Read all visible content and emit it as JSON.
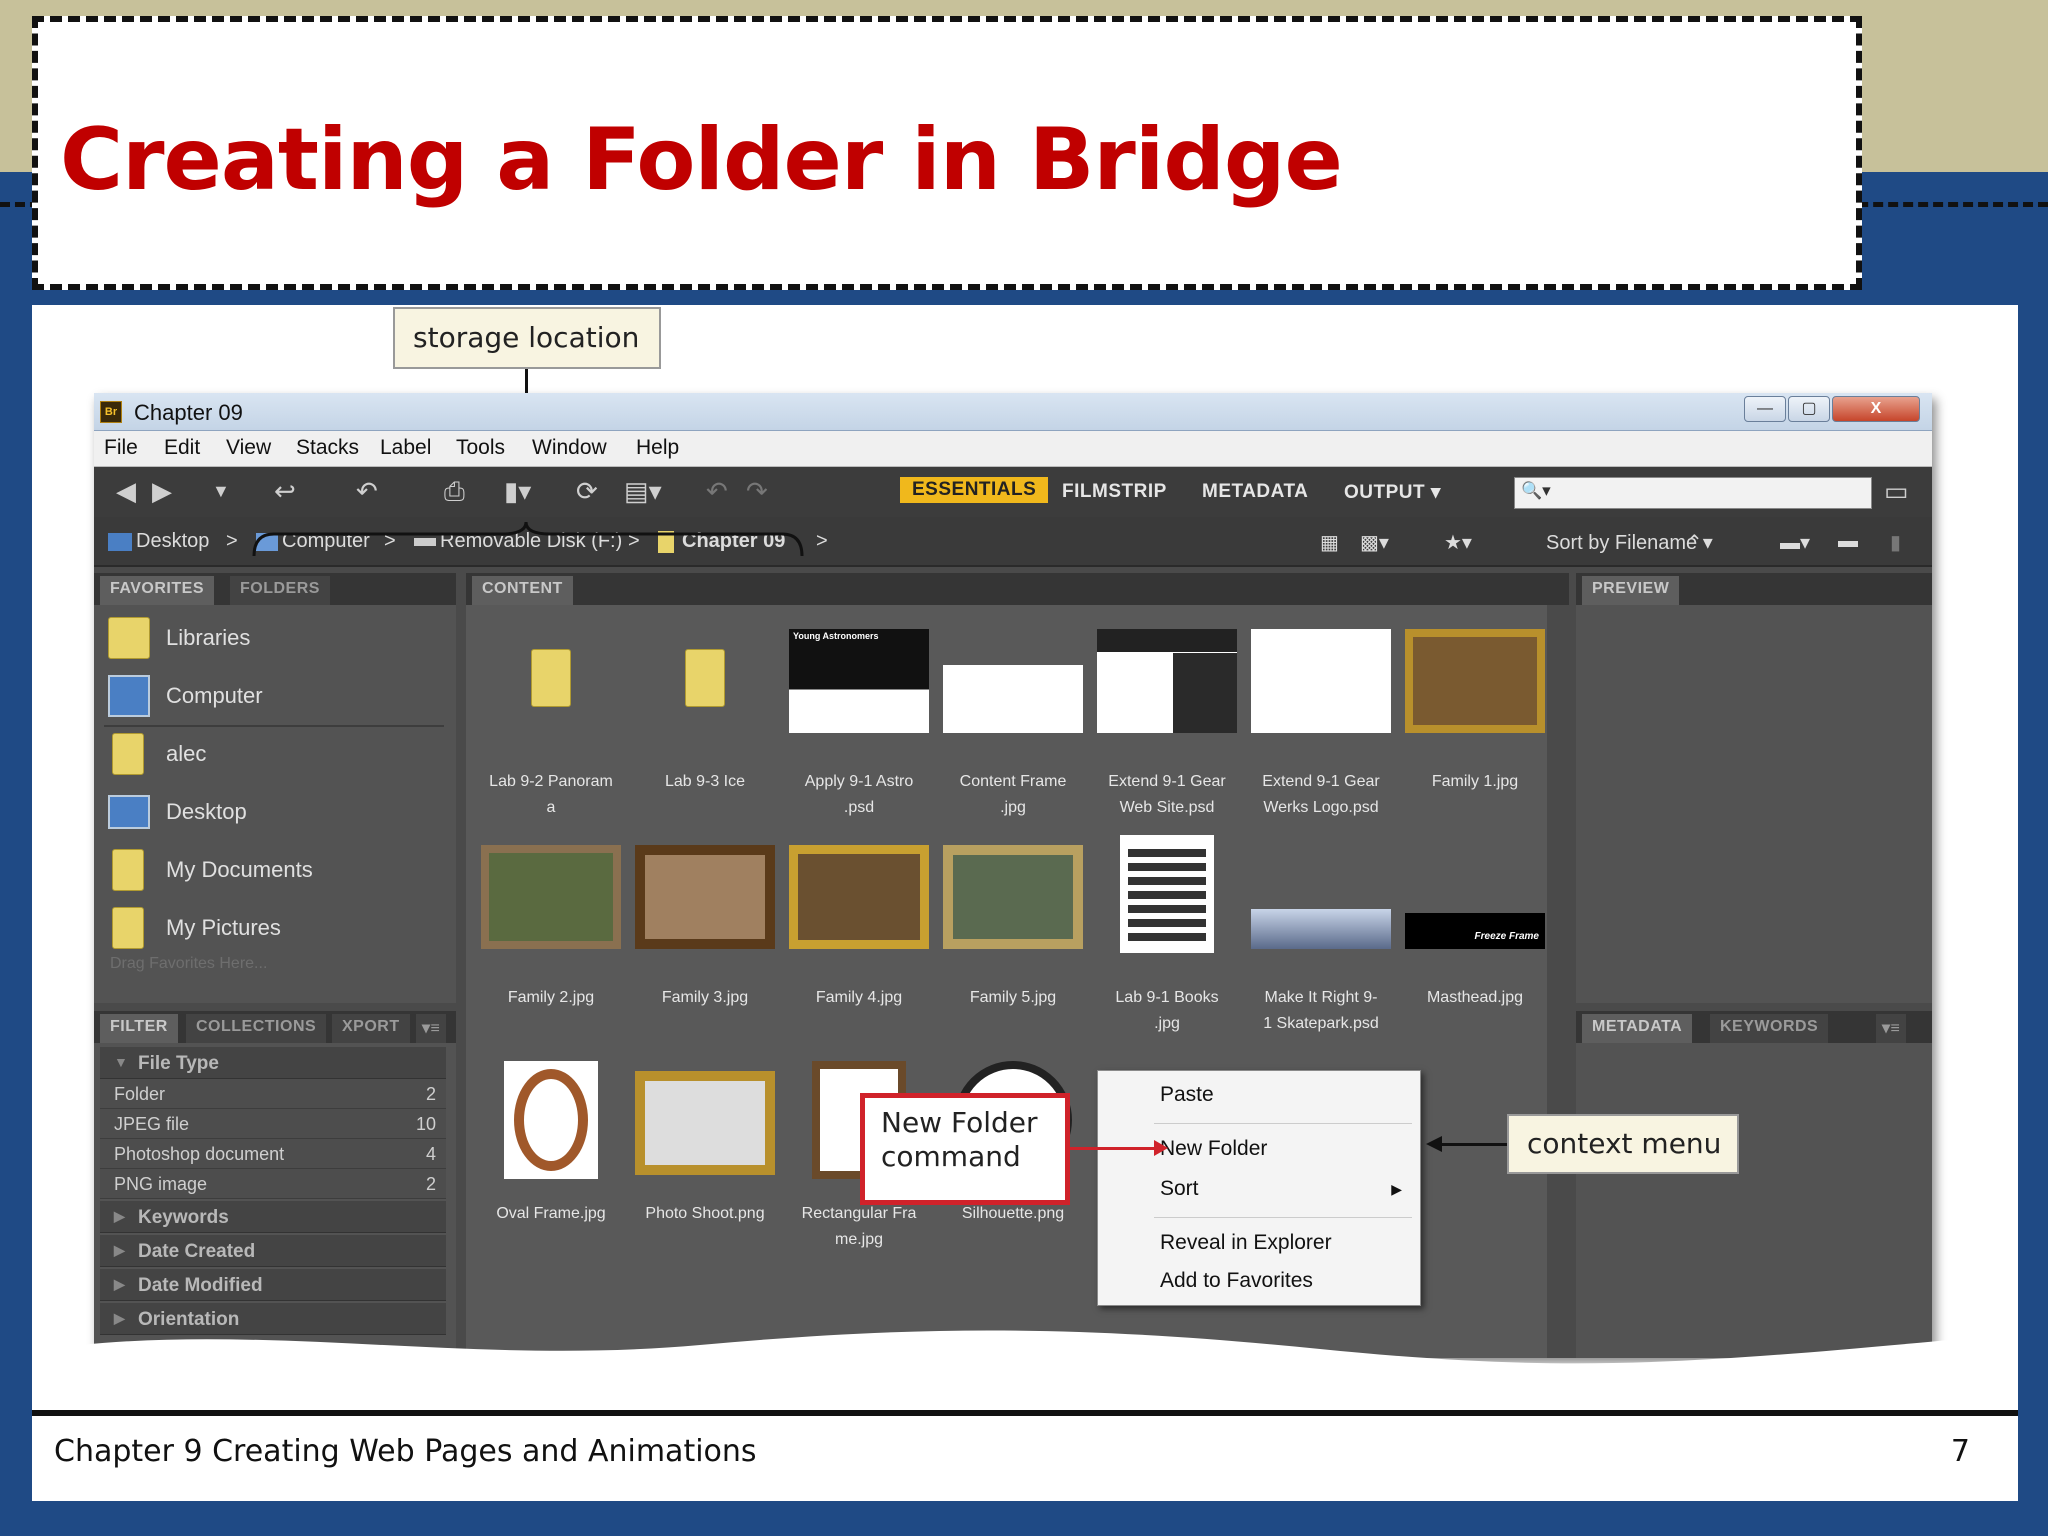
{
  "slide": {
    "title": "Creating a Folder in Bridge",
    "footer": "Chapter 9 Creating Web Pages and Animations",
    "page": "7"
  },
  "callouts": {
    "storage": "storage location",
    "context": "context menu",
    "new_folder_line1": "New Folder",
    "new_folder_line2": "command"
  },
  "window": {
    "title": "Chapter 09",
    "logo": "Br",
    "min": "—",
    "max": "▢",
    "close": "X"
  },
  "menu": [
    "File",
    "Edit",
    "View",
    "Stacks",
    "Label",
    "Tools",
    "Window",
    "Help"
  ],
  "workspaces": {
    "essentials": "ESSENTIALS",
    "filmstrip": "FILMSTRIP",
    "metadata": "METADATA",
    "output": "OUTPUT ▾"
  },
  "search": {
    "icon": "🔍▾",
    "value": ""
  },
  "path": {
    "desktop": "Desktop",
    "computer": "Computer",
    "disk": "Removable Disk (F:)",
    "folder": "Chapter 09",
    "sep": ">",
    "sort": "Sort by Filename ▾"
  },
  "tabs": {
    "favorites": "FAVORITES",
    "folders": "FOLDERS",
    "content": "CONTENT",
    "preview": "PREVIEW",
    "filter": "FILTER",
    "collections": "COLLECTIONS",
    "export": "XPORT",
    "metadata": "METADATA",
    "keywords": "KEYWORDS"
  },
  "favorites": [
    "Libraries",
    "Computer",
    "alec",
    "Desktop",
    "My Documents",
    "My Pictures"
  ],
  "favorites_hint": "Drag Favorites Here...",
  "filter": {
    "section": "File Type",
    "rows": [
      {
        "k": "Folder",
        "v": "2"
      },
      {
        "k": "JPEG file",
        "v": "10"
      },
      {
        "k": "Photoshop document",
        "v": "4"
      },
      {
        "k": "PNG image",
        "v": "2"
      }
    ],
    "sections": [
      "Keywords",
      "Date Created",
      "Date Modified",
      "Orientation"
    ]
  },
  "thumbs": [
    {
      "l1": "Lab 9-2 Panoram",
      "l2": "a"
    },
    {
      "l1": "Lab 9-3 Ice",
      "l2": ""
    },
    {
      "l1": "Apply 9-1 Astro",
      "l2": ".psd"
    },
    {
      "l1": "Content Frame",
      "l2": ".jpg"
    },
    {
      "l1": "Extend 9-1 Gear",
      "l2": "Web Site.psd"
    },
    {
      "l1": "Extend 9-1 Gear",
      "l2": "Werks Logo.psd"
    },
    {
      "l1": "Family 1.jpg",
      "l2": ""
    },
    {
      "l1": "Family 2.jpg",
      "l2": ""
    },
    {
      "l1": "Family 3.jpg",
      "l2": ""
    },
    {
      "l1": "Family 4.jpg",
      "l2": ""
    },
    {
      "l1": "Family 5.jpg",
      "l2": ""
    },
    {
      "l1": "Lab 9-1 Books",
      "l2": ".jpg"
    },
    {
      "l1": "Make It Right 9-",
      "l2": "1 Skatepark.psd"
    },
    {
      "l1": "Masthead.jpg",
      "l2": ""
    },
    {
      "l1": "Oval Frame.jpg",
      "l2": ""
    },
    {
      "l1": "Photo Shoot.png",
      "l2": ""
    },
    {
      "l1": "Rectangular Fra",
      "l2": "me.jpg"
    },
    {
      "l1": "Silhouette.png",
      "l2": ""
    }
  ],
  "thumb_texts": {
    "astro": "Young Astronomers",
    "masthead": "Freeze Frame"
  },
  "context_menu": [
    "Paste",
    "New Folder",
    "Sort",
    "Reveal in Explorer",
    "Add to Favorites"
  ]
}
